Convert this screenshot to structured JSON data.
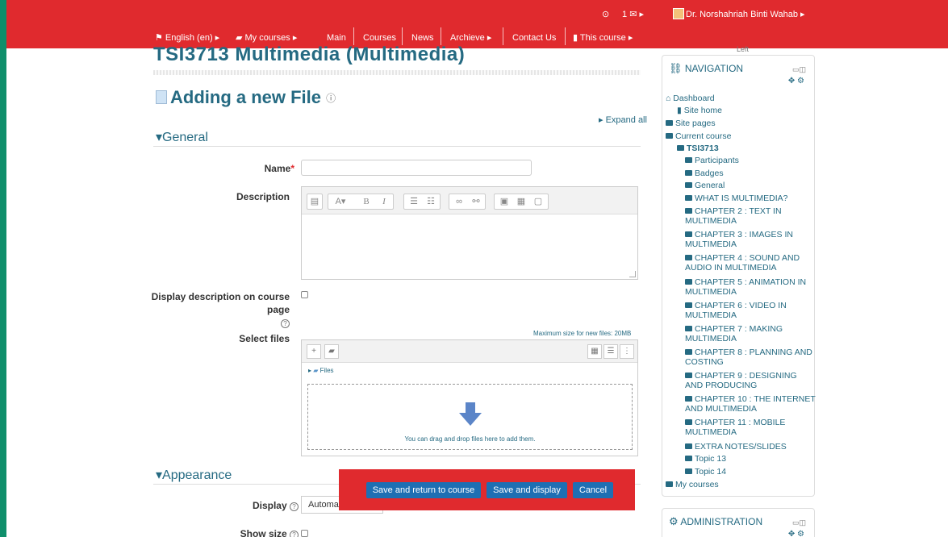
{
  "topbar": {
    "notifications_count": "1",
    "user_name": "Dr. Norshahriah Binti Wahab",
    "nav": [
      {
        "label": "English (en)",
        "icon": "flag-icon"
      },
      {
        "label": "My courses",
        "icon": "briefcase-icon"
      },
      {
        "label": "Main"
      },
      {
        "label": "Courses"
      },
      {
        "label": "News"
      },
      {
        "label": "Archieve"
      },
      {
        "label": "Contact Us"
      },
      {
        "label": "This course",
        "icon": "book-icon"
      }
    ]
  },
  "course_title": "TSI3713 Multimedia (Multimedia)",
  "page_heading": "Adding a new File",
  "expand_all": "Expand all",
  "sections": {
    "general": "General",
    "appearance": "Appearance"
  },
  "form": {
    "name_label": "Name",
    "description_label": "Description",
    "display_description_label_1": "Display description on course",
    "display_description_label_2": "page",
    "select_files_label": "Select files",
    "max_size": "Maximum size for new files: 20MB",
    "files_path": "Files",
    "drop_text": "You can drag and drop files here to add them.",
    "display_label": "Display",
    "display_value": "Automatic",
    "show_size_label": "Show size"
  },
  "buttons": {
    "save_return": "Save and return to course",
    "save_display": "Save and display",
    "cancel": "Cancel"
  },
  "sidebar": {
    "left_label": "Left",
    "navigation_title": "NAVIGATION",
    "administration_title": "ADMINISTRATION",
    "items": [
      "Dashboard",
      "Site home",
      "Site pages",
      "Current course",
      "TSI3713",
      "Participants",
      "Badges",
      "General",
      "WHAT IS MULTIMEDIA?",
      "CHAPTER 2 : TEXT IN MULTIMEDIA",
      "CHAPTER 3 : IMAGES IN MULTIMEDIA",
      "CHAPTER 4 : SOUND AND AUDIO IN MULTIMEDIA",
      "CHAPTER 5 : ANIMATION IN MULTIMEDIA",
      "CHAPTER 6 : VIDEO IN MULTIMEDIA",
      "CHAPTER 7 : MAKING MULTIMEDIA",
      "CHAPTER 8 : PLANNING AND COSTING",
      "CHAPTER 9 : DESIGNING AND PRODUCING",
      "CHAPTER 10 : THE INTERNET AND MULTIMEDIA",
      "CHAPTER 11 : MOBILE MULTIMEDIA",
      "EXTRA NOTES/SLIDES",
      "Topic 13",
      "Topic 14",
      "My courses"
    ]
  },
  "colors": {
    "brand_red": "#e02a2e",
    "heading_blue": "#256a82",
    "button_blue": "#1e6fb3"
  }
}
